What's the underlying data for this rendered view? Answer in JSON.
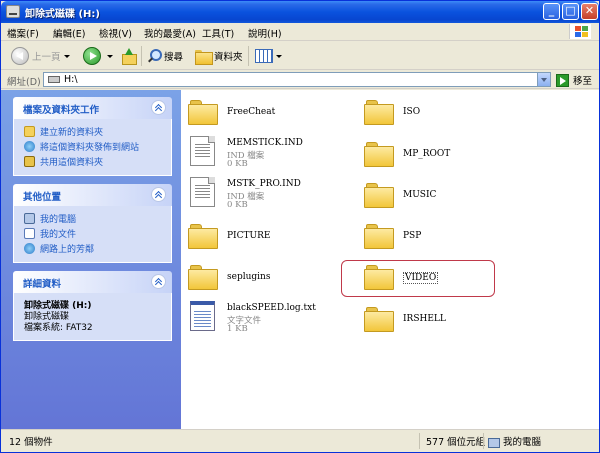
{
  "window": {
    "title": "卸除式磁碟 (H:)"
  },
  "title_buttons": {
    "minimize": "_",
    "maximize": "□",
    "close": "✕"
  },
  "menu": [
    "檔案(F)",
    "編輯(E)",
    "檢視(V)",
    "我的最愛(A)",
    "工具(T)",
    "說明(H)"
  ],
  "toolbar": {
    "back": "上一頁",
    "search": "搜尋",
    "folders": "資料夾"
  },
  "address": {
    "label": "網址(D)",
    "value": "H:\\",
    "go": "移至"
  },
  "tasks_panel": {
    "title": "檔案及資料夾工作",
    "items": [
      "建立新的資料夾",
      "將這個資料夾發佈到網站",
      "共用這個資料夾"
    ]
  },
  "places_panel": {
    "title": "其他位置",
    "items": [
      "我的電腦",
      "我的文件",
      "網路上的芳鄰"
    ]
  },
  "details_panel": {
    "title": "詳細資料",
    "name": "卸除式磁碟 (H:)",
    "type": "卸除式磁碟",
    "fs": "檔案系統: FAT32"
  },
  "files": [
    {
      "name": "FreeCheat",
      "kind": "folder"
    },
    {
      "name": "ISO",
      "kind": "folder"
    },
    {
      "name": "MEMSTICK.IND",
      "kind": "file",
      "type": "IND 檔案",
      "size": "0 KB"
    },
    {
      "name": "MP_ROOT",
      "kind": "folder"
    },
    {
      "name": "MSTK_PRO.IND",
      "kind": "file",
      "type": "IND 檔案",
      "size": "0 KB"
    },
    {
      "name": "MUSIC",
      "kind": "folder"
    },
    {
      "name": "PICTURE",
      "kind": "folder"
    },
    {
      "name": "PSP",
      "kind": "folder"
    },
    {
      "name": "seplugins",
      "kind": "folder"
    },
    {
      "name": "VIDEO",
      "kind": "folder",
      "selected": true
    },
    {
      "name": "blackSPEED.log.txt",
      "kind": "text",
      "type": "文字文件",
      "size": "1 KB"
    },
    {
      "name": "IRSHELL",
      "kind": "folder"
    }
  ],
  "status": {
    "count": "12 個物件",
    "size": "577 個位元組",
    "location": "我的電腦"
  },
  "colors": {
    "titlebar": "#0a52de",
    "task_link": "#215dc6",
    "left_pane": "#6375d6",
    "highlight_ring": "#c0394a"
  }
}
